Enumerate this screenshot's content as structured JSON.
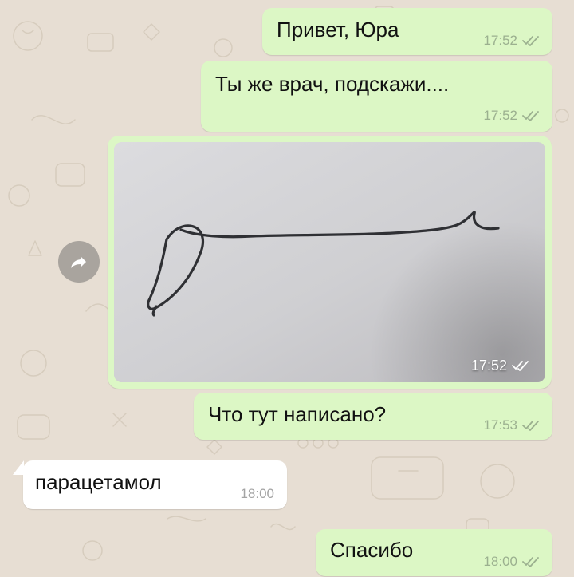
{
  "messages": [
    {
      "text": "Привет, Юра",
      "time": "17:52"
    },
    {
      "text": "Ты же врач, подскажи....",
      "time": "17:52"
    },
    {
      "photo_time": "17:52"
    },
    {
      "text": "Что тут написано?",
      "time": "17:53"
    },
    {
      "text": "парацетамол",
      "time": "18:00"
    },
    {
      "text": "Спасибо",
      "time": "18:00"
    }
  ],
  "icons": {
    "forward": "forward-arrow-icon",
    "double_check": "double-check-icon"
  },
  "colors": {
    "chat_background": "#e7ded3",
    "outgoing_bubble": "#dcf7c5",
    "incoming_bubble": "#ffffff",
    "meta_text": "#9bb08f"
  }
}
